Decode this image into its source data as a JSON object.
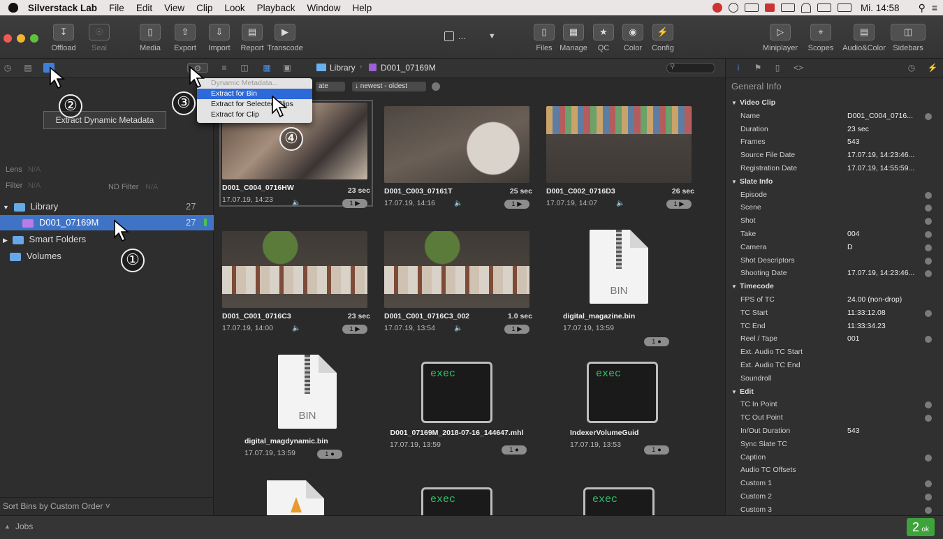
{
  "menubar": {
    "app": "Silverstack Lab",
    "items": [
      "File",
      "Edit",
      "View",
      "Clip",
      "Look",
      "Playback",
      "Window",
      "Help"
    ],
    "clock": "Mi. 14:58"
  },
  "toolbar": {
    "left": [
      {
        "label": "Offload",
        "icon": "↧",
        "dim": false
      },
      {
        "label": "Seal",
        "icon": "☉",
        "dim": true
      },
      {
        "label": "Media",
        "icon": "▯",
        "dim": false
      },
      {
        "label": "Export",
        "icon": "⇧",
        "dim": false
      },
      {
        "label": "Import",
        "icon": "⇩",
        "dim": false
      },
      {
        "label": "Report",
        "icon": "▤",
        "dim": false
      },
      {
        "label": "Transcode",
        "icon": "▶",
        "dim": false
      }
    ],
    "center_ellipsis": "...",
    "mid": [
      {
        "label": "Files",
        "icon": "▯"
      },
      {
        "label": "Manage",
        "icon": "▦"
      },
      {
        "label": "QC",
        "icon": "★"
      },
      {
        "label": "Color",
        "icon": "◉"
      },
      {
        "label": "Config",
        "icon": "⚡"
      }
    ],
    "right": [
      {
        "label": "Miniplayer",
        "icon": "▷"
      },
      {
        "label": "Scopes",
        "icon": "⌖"
      },
      {
        "label": "Audio&Color",
        "icon": "▤"
      },
      {
        "label": "Sidebars",
        "icon": "◫"
      }
    ]
  },
  "breadcrumb": {
    "library": "Library",
    "bin": "D001_07169M"
  },
  "sort": {
    "field": "ate",
    "order": "↓ newest - oldest"
  },
  "dropdown": {
    "title": "Dynamic Metadata...",
    "items": [
      "Extract for Bin",
      "Extract for Selected Clips",
      "Extract for Clip"
    ]
  },
  "tooltip": "Extract Dynamic Metadata",
  "left_panel": {
    "lens_label": "Lens",
    "lens_value": "N/A",
    "filter_label": "Filter",
    "filter_value": "N/A",
    "nd_label": "ND Filter",
    "nd_value": "N/A",
    "tree": [
      {
        "label": "Library",
        "count": "27"
      },
      {
        "label": "D001_07169M",
        "count": "27"
      },
      {
        "label": "Smart Folders",
        "count": ""
      },
      {
        "label": "Volumes",
        "count": ""
      }
    ],
    "sort_bins": "Sort Bins by Custom Order ˅"
  },
  "clips": [
    {
      "name": "D001_C004_0716HW",
      "dur": "23 sec",
      "date": "17.07.19, 14:23",
      "badge": "1 ▶"
    },
    {
      "name": "D001_C003_07161T",
      "dur": "25 sec",
      "date": "17.07.19, 14:16",
      "badge": "1 ▶"
    },
    {
      "name": "D001_C002_0716D3",
      "dur": "26 sec",
      "date": "17.07.19, 14:07",
      "badge": "1 ▶"
    },
    {
      "name": "D001_C001_0716C3",
      "dur": "23 sec",
      "date": "17.07.19, 14:00",
      "badge": "1 ▶"
    },
    {
      "name": "D001_C001_0716C3_002",
      "dur": "1.0 sec",
      "date": "17.07.19, 13:54",
      "badge": "1 ▶"
    }
  ],
  "files": [
    {
      "name": "digital_magazine.bin",
      "date": "17.07.19, 13:59",
      "icon": "BIN",
      "badge": "1 ●"
    },
    {
      "name": "digital_magdynamic.bin",
      "date": "17.07.19, 13:59",
      "icon": "BIN",
      "badge": "1 ●"
    },
    {
      "name": "D001_07169M_2018-07-16_144647.mhl",
      "date": "17.07.19, 13:59",
      "icon": "exec",
      "badge": "1 ●"
    },
    {
      "name": "IndexerVolumeGuid",
      "date": "17.07.19, 13:53",
      "icon": "exec",
      "badge": "1 ●"
    }
  ],
  "bottom_row_icons": [
    "exec",
    "exec"
  ],
  "general_info": {
    "title": "General Info",
    "rows": [
      {
        "h": true,
        "k": "Video Clip"
      },
      {
        "k": "Name",
        "v": "D001_C004_0716...",
        "d": true
      },
      {
        "k": "Duration",
        "v": "23 sec"
      },
      {
        "k": "Frames",
        "v": "543"
      },
      {
        "k": "Source File Date",
        "v": "17.07.19, 14:23:46..."
      },
      {
        "k": "Registration Date",
        "v": "17.07.19, 14:55:59..."
      },
      {
        "h": true,
        "k": "Slate Info"
      },
      {
        "k": "Episode",
        "d": true
      },
      {
        "k": "Scene",
        "d": true
      },
      {
        "k": "Shot",
        "d": true
      },
      {
        "k": "Take",
        "v": "004",
        "d": true
      },
      {
        "k": "Camera",
        "v": "D",
        "d": true
      },
      {
        "k": "Shot Descriptors",
        "d": true
      },
      {
        "k": "Shooting Date",
        "v": "17.07.19, 14:23:46...",
        "d": true
      },
      {
        "h": true,
        "k": "Timecode"
      },
      {
        "k": "FPS of TC",
        "v": "24.00 (non-drop)"
      },
      {
        "k": "TC Start",
        "v": "11:33:12.08",
        "d": true
      },
      {
        "k": "TC End",
        "v": "11:33:34.23"
      },
      {
        "k": "Reel / Tape",
        "v": "001",
        "d": true
      },
      {
        "k": "Ext. Audio TC Start"
      },
      {
        "k": "Ext. Audio TC End"
      },
      {
        "k": "Soundroll"
      },
      {
        "h": true,
        "k": "Edit"
      },
      {
        "k": "TC In Point",
        "d": true
      },
      {
        "k": "TC Out Point",
        "d": true
      },
      {
        "k": "In/Out Duration",
        "v": "543"
      },
      {
        "k": "Sync Slate TC"
      },
      {
        "k": "Caption",
        "d": true
      },
      {
        "k": "Audio TC Offsets"
      },
      {
        "k": "Custom 1",
        "d": true
      },
      {
        "k": "Custom 2",
        "d": true
      },
      {
        "k": "Custom 3",
        "d": true
      }
    ]
  },
  "callouts": [
    "①",
    "②",
    "③",
    "④"
  ],
  "jobs": {
    "label": "Jobs",
    "count": "2",
    "ok": "ok"
  },
  "colors": {
    "accent": "#3f73c6",
    "ok_badge": "#3ea33a",
    "exec_text": "#34c26b"
  }
}
